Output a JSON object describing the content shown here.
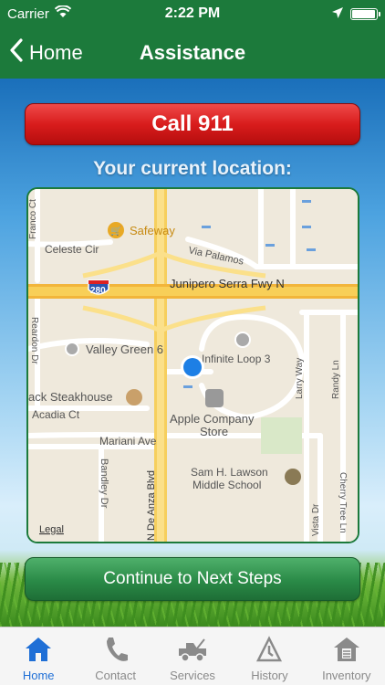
{
  "status": {
    "carrier": "Carrier",
    "time": "2:22 PM",
    "battery_level": 0.95
  },
  "nav": {
    "back_label": "Home",
    "title": "Assistance"
  },
  "call_button": {
    "label": "Call 911"
  },
  "location_label": "Your current location:",
  "map": {
    "labels": {
      "safeway": "Safeway",
      "celeste": "Celeste Cir",
      "via_palamos": "Via Palamos",
      "junipero": "Junipero Serra Fwy N",
      "shield_280": "280",
      "valley_green": "Valley Green 6",
      "infinite_loop": "Infinite Loop 3",
      "steakhouse": "ack Steakhouse",
      "acadia": "Acadia Ct",
      "apple_store_1": "Apple Company",
      "apple_store_2": "Store",
      "mariani": "Mariani Ave",
      "bandley": "Bandley Dr",
      "de_anza": "N De Anza Blvd",
      "sam_lawson_1": "Sam H. Lawson",
      "sam_lawson_2": "Middle School",
      "larry_way": "Larry Way",
      "randy_ln": "Randy Ln",
      "vista_dr": "Vista Dr",
      "cherry_tree": "Cherry Tree Ln",
      "reardon": "Reardon Dr",
      "franco": "Franco Ct",
      "legal": "Legal"
    }
  },
  "continue_button": {
    "label": "Continue to Next Steps"
  },
  "tabs": [
    {
      "label": "Home",
      "icon": "home-icon",
      "active": true
    },
    {
      "label": "Contact",
      "icon": "phone-icon",
      "active": false
    },
    {
      "label": "Services",
      "icon": "tow-truck-icon",
      "active": false
    },
    {
      "label": "History",
      "icon": "history-icon",
      "active": false
    },
    {
      "label": "Inventory",
      "icon": "inventory-icon",
      "active": false
    }
  ],
  "colors": {
    "brand_green": "#1c7a3b",
    "call_red": "#d91c1c",
    "active_tab": "#1f6fd6"
  }
}
